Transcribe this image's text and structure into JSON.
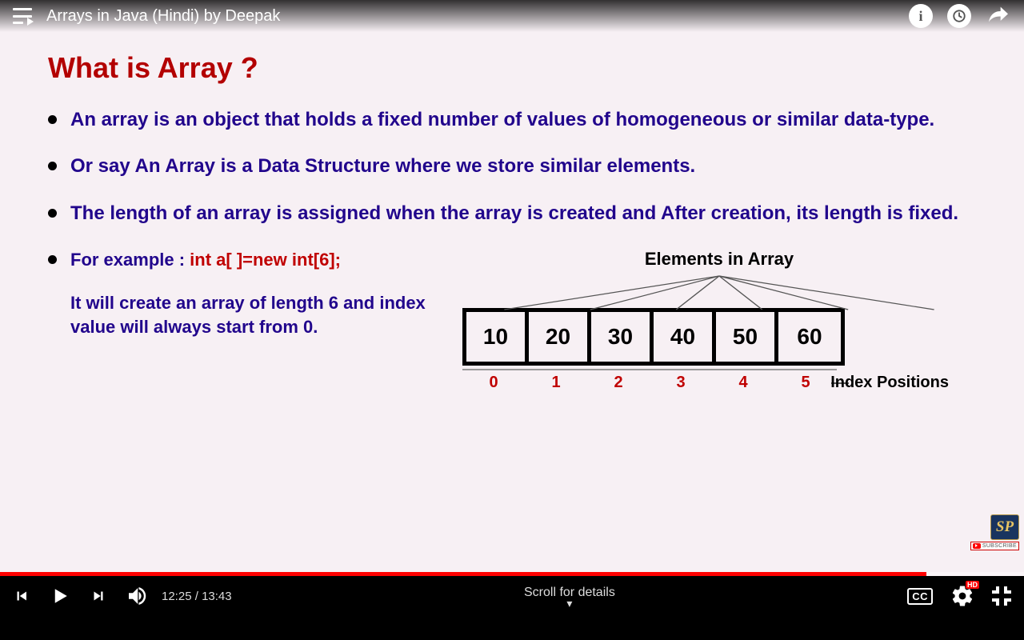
{
  "video": {
    "title": "Arrays in Java (Hindi) by Deepak",
    "current_time": "12:25",
    "duration": "13:43",
    "scroll_hint": "Scroll for details"
  },
  "top_icons": {
    "info": "i",
    "watch_later": "clock",
    "share": "share"
  },
  "controls": {
    "cc": "CC",
    "quality_badge": "HD"
  },
  "slide": {
    "heading": "What is Array ?",
    "bullets": [
      "An array is an object that holds a fixed number of values of homogeneous or similar data-type.",
      "Or say An Array is a Data Structure where we store similar elements.",
      "The length of an array is assigned when the array is created and After creation, its length is fixed."
    ],
    "example_prefix": "For example : ",
    "example_code": "int a[ ]=new int[6];",
    "example_desc": "It will create an array of length 6 and index value will always start from 0.",
    "elements_label": "Elements in Array",
    "cells": [
      "10",
      "20",
      "30",
      "40",
      "50",
      "60"
    ],
    "indices": [
      "0",
      "1",
      "2",
      "3",
      "4",
      "5"
    ],
    "index_label": "Index Positions"
  },
  "watermark": {
    "logo_text": "SP",
    "subscribe": "SUBSCRIBE"
  }
}
